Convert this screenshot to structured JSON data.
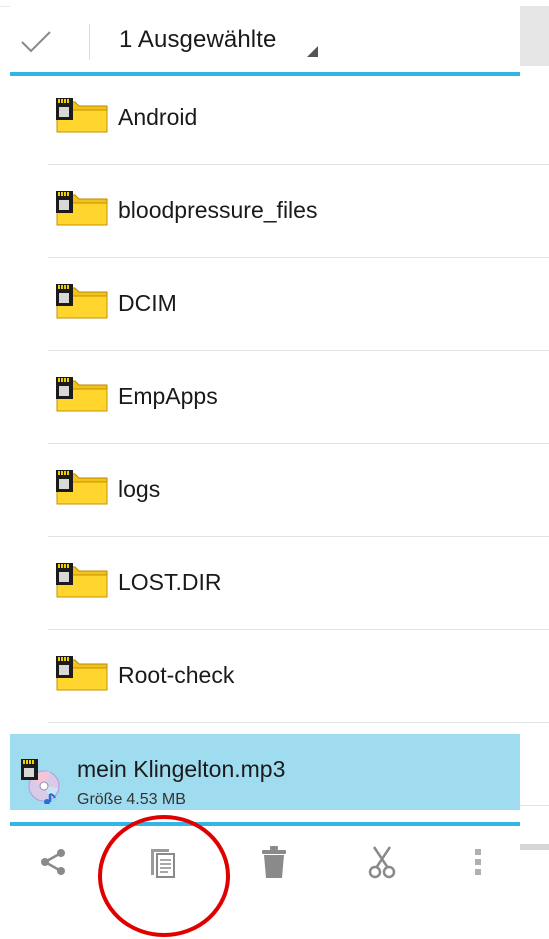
{
  "action_bar": {
    "done_icon": "checkmark-icon",
    "selection_label": "1 Ausgewählte",
    "dropdown_icon": "corner-triangle-icon",
    "accent_color": "#33b5e5"
  },
  "folders": [
    {
      "name": "Android",
      "icon": "sd-card-folder-icon"
    },
    {
      "name": "bloodpressure_files",
      "icon": "sd-card-folder-icon"
    },
    {
      "name": "DCIM",
      "icon": "sd-card-folder-icon"
    },
    {
      "name": "EmpApps",
      "icon": "sd-card-folder-icon"
    },
    {
      "name": "logs",
      "icon": "sd-card-folder-icon"
    },
    {
      "name": "LOST.DIR",
      "icon": "sd-card-folder-icon"
    },
    {
      "name": "Root-check",
      "icon": "sd-card-folder-icon"
    }
  ],
  "selected_file": {
    "name": "mein Klingelton.mp3",
    "size_label": "Größe",
    "size_value": "4.53 MB",
    "icon": "audio-file-icon",
    "highlight_color": "#9fdcf0"
  },
  "bottom_actions": [
    {
      "action": "share",
      "icon": "share-icon"
    },
    {
      "action": "copy",
      "icon": "copy-icon"
    },
    {
      "action": "delete",
      "icon": "trash-icon"
    },
    {
      "action": "cut",
      "icon": "scissors-icon"
    },
    {
      "action": "more",
      "icon": "overflow-menu-icon"
    }
  ],
  "annotation": {
    "shape": "circle",
    "target": "copy",
    "color": "#e00000"
  }
}
